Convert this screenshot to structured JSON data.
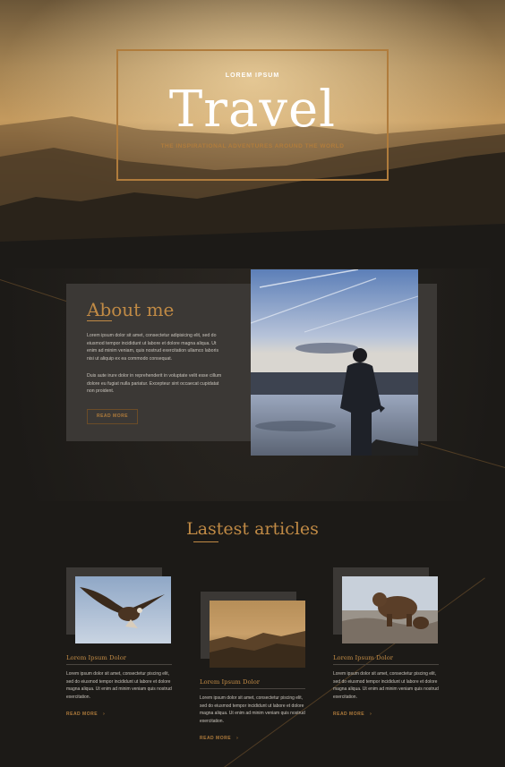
{
  "hero": {
    "kicker": "LOREM IPSUM",
    "title": "Travel",
    "subtitle": "THE INSPIRATIONAL ADVENTURES AROUND THE WORLD"
  },
  "about": {
    "title": "About me",
    "paragraphs": [
      "Lorem ipsum dolor sit amet, consectetur adipisicing elit, sed do eiusmod tempor incididunt ut labore et dolore magna aliqua. Ut enim ad minim veniam, quis nostrud exercitation ullamco laboris nisi ut aliquip ex ea commodo consequat.",
      "Duis aute irure dolor in reprehenderit in voluptate velit esse cillum dolore eu fugiat nulla pariatur. Excepteur sint occaecat cupidatat non proident."
    ],
    "button_label": "READ MORE"
  },
  "articles": {
    "title": "Lastest articles",
    "cards": [
      {
        "title": "Lorem Ipsum Dolor",
        "text": "Lorem ipsum dolor sit amet, consectetur piscing elit, sed do eiusmod tempor incididunt ut labore et dolore magna aliqua. Ut enim ad minim veniam quis nostrud exercitation.",
        "more": "READ MORE",
        "chevron": "›",
        "image_icon": "eagle-image"
      },
      {
        "title": "Lorem Ipsum Dolor",
        "text": "Lorem ipsum dolor sit amet, consectetur piscing elit, sed do eiusmod tempor incididunt ut labore et dolore magna aliqua. Ut enim ad minim veniam quis nostrud exercitation.",
        "more": "READ MORE",
        "chevron": "›",
        "image_icon": "forest-image"
      },
      {
        "title": "Lorem Ipsum Dolor",
        "text": "Lorem ipsum dolor sit amet, consectetur piscing elit, sed do eiusmod tempor incididunt ut labore et dolore magna aliqua. Ut enim ad minim veniam quis nostrud exercitation.",
        "more": "READ MORE",
        "chevron": "›",
        "image_icon": "bear-image"
      }
    ]
  },
  "colors": {
    "accent": "#c08a45",
    "background": "#1c1a17",
    "panel": "#3b3835"
  }
}
